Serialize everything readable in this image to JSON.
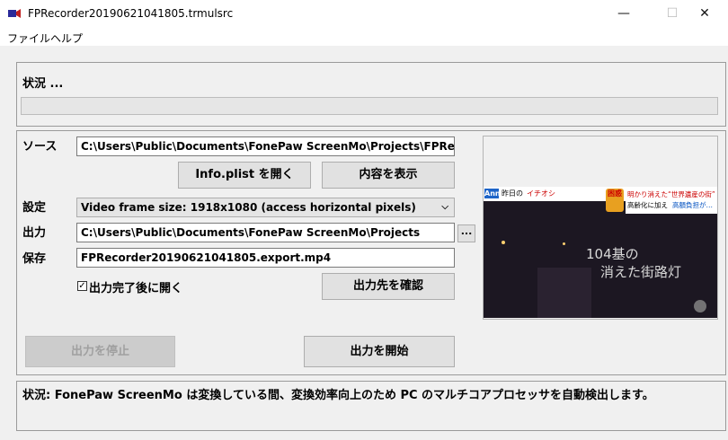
{
  "window": {
    "title": "FPRecorder20190621041805.trmulsrc",
    "minimize": "—",
    "maximize": "☐",
    "close": "✕"
  },
  "menu": [
    "ファイル",
    "ヘルプ"
  ],
  "status_top": {
    "label": "状況 ...",
    "progress": 0
  },
  "form": {
    "source_label": "ソース",
    "source_value": "C:\\Users\\Public\\Documents\\FonePaw ScreenMo\\Projects\\FPRecor",
    "info_plist_button": "Info.plist を開く",
    "show_content_button": "内容を表示",
    "settings_label": "設定",
    "settings_value": "Video frame size: 1918x1080 (access horizontal pixels)",
    "output_label": "出力",
    "output_value": "C:\\Users\\Public\\Documents\\FonePaw ScreenMo\\Projects",
    "browse_button": "...",
    "save_label": "保存",
    "save_value": "FPRecorder20190621041805.export.mp4",
    "open_after_checkbox": "出力完了後に開く",
    "open_after_checked": true,
    "check_dest_button": "出力先を確認",
    "stop_button": "出力を停止",
    "start_button": "出力を開始"
  },
  "preview": {
    "channel_logo": "Ann",
    "ticker": "昨日の",
    "ticker_b": "イチオシ",
    "badge": "困惑",
    "headline_1": "明かり消えた“世界遺産の街”",
    "headline_2": "高齢化に加え",
    "headline_3": "高額負担が…",
    "caption_1": "104基の",
    "caption_2": "消えた街路灯"
  },
  "status_bottom": "状況: FonePaw ScreenMo は変換している間、変換効率向上のため PC のマルチコアプロセッサを自動検出します。"
}
